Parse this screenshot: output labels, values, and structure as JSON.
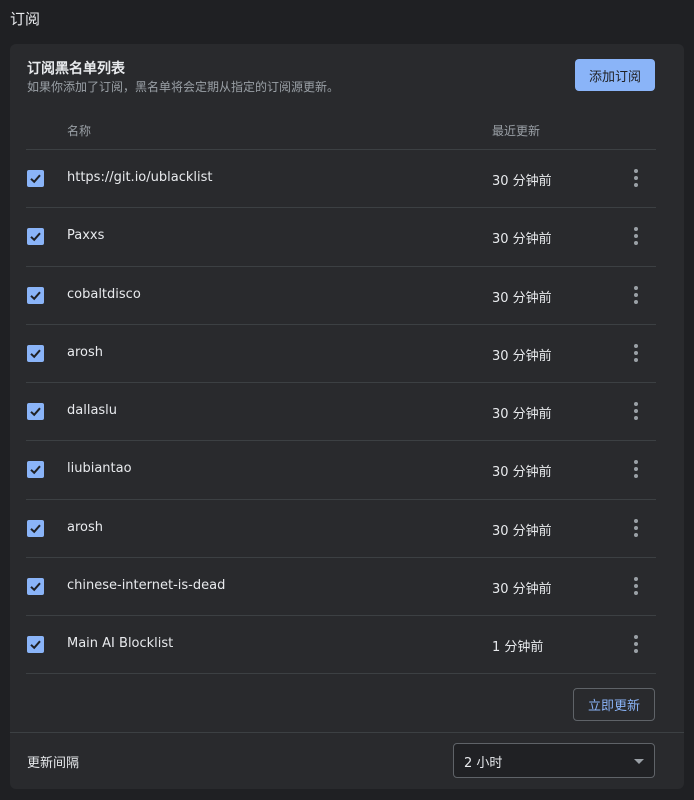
{
  "page": {
    "title": "订阅"
  },
  "subscriptions": {
    "title": "订阅黑名单列表",
    "description": "如果你添加了订阅，黑名单将会定期从指定的订阅源更新。",
    "add_button": "添加订阅",
    "columns": {
      "name": "名称",
      "updated": "最近更新"
    },
    "items": [
      {
        "name": "https://git.io/ublacklist",
        "updated": "30 分钟前",
        "enabled": true
      },
      {
        "name": "Paxxs",
        "updated": "30 分钟前",
        "enabled": true
      },
      {
        "name": "cobaltdisco",
        "updated": "30 分钟前",
        "enabled": true
      },
      {
        "name": "arosh",
        "updated": "30 分钟前",
        "enabled": true
      },
      {
        "name": "dallaslu",
        "updated": "30 分钟前",
        "enabled": true
      },
      {
        "name": "liubiantao",
        "updated": "30 分钟前",
        "enabled": true
      },
      {
        "name": "arosh",
        "updated": "30 分钟前",
        "enabled": true
      },
      {
        "name": "chinese-internet-is-dead",
        "updated": "30 分钟前",
        "enabled": true
      },
      {
        "name": "Main AI Blocklist",
        "updated": "1 分钟前",
        "enabled": true
      }
    ],
    "update_now_button": "立即更新"
  },
  "interval": {
    "label": "更新间隔",
    "selected": "2 小时"
  },
  "colors": {
    "accent": "#8ab4f8",
    "background": "#1f2023",
    "card": "#292a2d",
    "divider": "#3c4043"
  }
}
